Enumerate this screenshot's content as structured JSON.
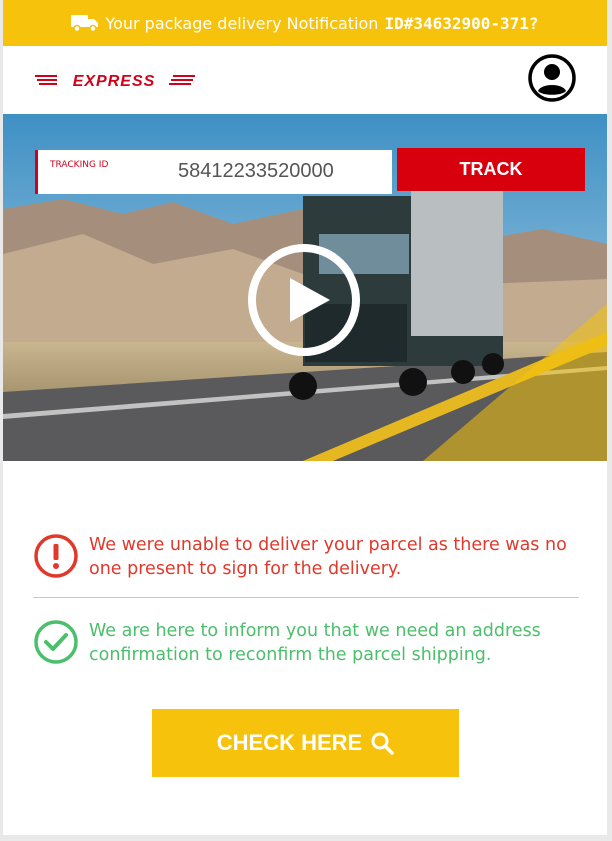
{
  "topbar": {
    "text": "Your package delivery Notification",
    "id": "ID#34632900-371?",
    "icon": "truck-icon"
  },
  "header": {
    "logo_text": "EXPRESS",
    "logo_color": "#d0021b",
    "avatar_icon": "user-circle-icon"
  },
  "tracking": {
    "label": "TRACKING ID",
    "value": "58412233520000",
    "button": "TRACK"
  },
  "video": {
    "icon": "play-icon"
  },
  "messages": {
    "error": "We were unable to deliver your parcel as there was no one present to sign for the delivery.",
    "success": "We are here to inform you that we need an address confirmation to reconfirm the parcel shipping."
  },
  "cta": {
    "label": "CHECK HERE",
    "icon": "search-icon"
  },
  "colors": {
    "accent_yellow": "#f6c20b",
    "brand_red": "#d0021b",
    "error_red": "#e0392b",
    "success_green": "#4bbf6b"
  }
}
